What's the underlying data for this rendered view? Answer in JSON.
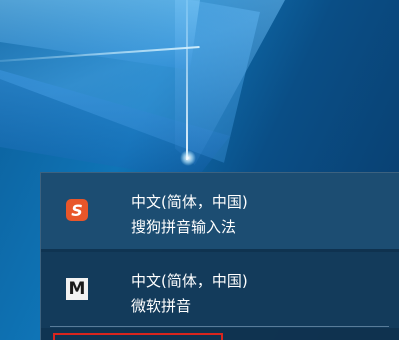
{
  "ime_list": [
    {
      "icon": "sogou-s-icon",
      "icon_glyph": "S",
      "icon_color": "#e8562a",
      "language": "中文(简体，中国)",
      "name": "搜狗拼音输入法",
      "selected": true
    },
    {
      "icon": "microsoft-m-icon",
      "icon_glyph": "M",
      "icon_color": "#f2f2f2",
      "language": "中文(简体，中国)",
      "name": "微软拼音",
      "selected": false
    }
  ],
  "colors": {
    "panel_bg": "#10324e",
    "selected_bg": "#1e5278",
    "highlight_border": "#d9251d"
  }
}
